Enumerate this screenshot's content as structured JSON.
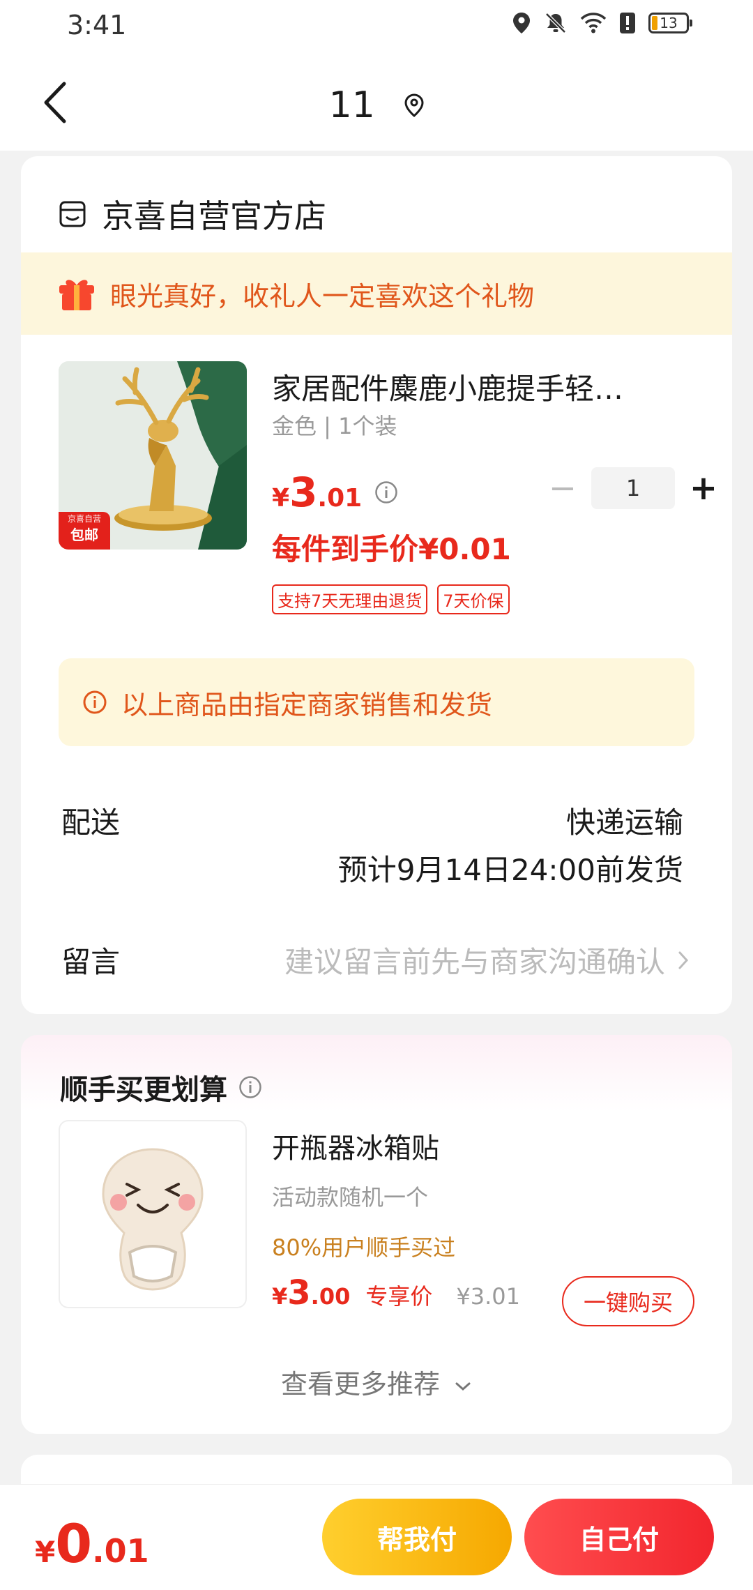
{
  "status_bar": {
    "time": "3:41",
    "battery": "13",
    "icons": [
      "location-icon",
      "mute-bell-icon",
      "wifi-icon",
      "alert-icon",
      "battery-icon"
    ]
  },
  "nav": {
    "title": "11",
    "icons": [
      "back-icon",
      "location-pin-icon"
    ]
  },
  "shop": {
    "name": "京喜自营官方店",
    "gift_text": "眼光真好，收礼人一定喜欢这个礼物"
  },
  "product": {
    "title": "家居配件麋鹿小鹿提手轻…",
    "spec": "金色 | 1个装",
    "price_yen": "¥",
    "price_int": "3",
    "price_dec": ".01",
    "quantity": "1",
    "minus": "−",
    "plus": "+",
    "final_price": "每件到手价¥0.01",
    "tags": [
      "支持7天无理由退货",
      "7天价保"
    ],
    "badge_top": "京喜自营",
    "badge_bottom": "包邮"
  },
  "seller_notice": "以上商品由指定商家销售和发货",
  "delivery": {
    "label": "配送",
    "method": "快递运输",
    "eta": "预计9月14日24:00前发货"
  },
  "message": {
    "label": "留言",
    "placeholder": "建议留言前先与商家沟通确认"
  },
  "recommend": {
    "title": "顺手买更划算",
    "name": "开瓶器冰箱贴",
    "desc": "活动款随机一个",
    "social": "80%用户顺手买过",
    "price_yen": "¥",
    "price_int": "3",
    "price_dec": ".00",
    "exclusive": "专享价",
    "original": "¥3.01",
    "buy_label": "一键购买",
    "see_more": "查看更多推荐"
  },
  "bottom": {
    "total_yen": "¥",
    "total_int": "0",
    "total_dec": ".01",
    "help_pay": "帮我付",
    "self_pay": "自己付"
  },
  "colors": {
    "accent_red": "#e8291c",
    "gift_orange": "#e0561b",
    "banner_bg": "#fdf6dc",
    "help_btn": "#f6a800",
    "self_btn": "#f2262e"
  }
}
